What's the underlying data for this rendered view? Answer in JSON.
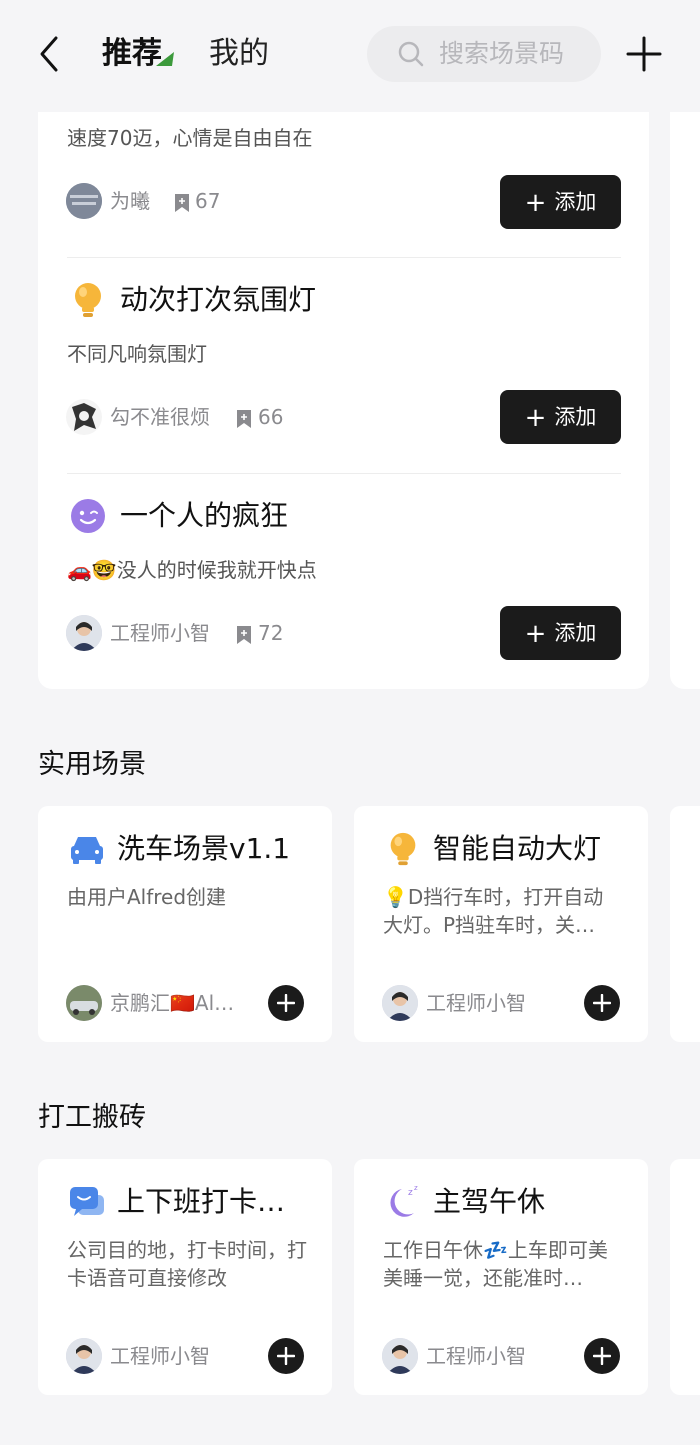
{
  "header": {
    "tab_recommend": "推荐",
    "tab_mine": "我的",
    "search_placeholder": "搜索场景码"
  },
  "feed": [
    {
      "title": "",
      "desc": "速度70迈，心情是自由自在",
      "author": "为曦",
      "count": "67",
      "add_label": "添加"
    },
    {
      "title": "动次打次氛围灯",
      "icon": "lightbulb-icon",
      "desc": "不同凡响氛围灯",
      "author": "勾不准很烦",
      "count": "66",
      "add_label": "添加"
    },
    {
      "title": "一个人的疯狂",
      "icon": "wink-face-icon",
      "desc": "🚗🤓没人的时候我就开快点",
      "author": "工程师小智",
      "count": "72",
      "add_label": "添加"
    }
  ],
  "sections": [
    {
      "title": "实用场景",
      "cards": [
        {
          "icon": "car-icon",
          "title": "洗车场景v1.1",
          "desc": "由用户Alfred创建",
          "author": "京鹏汇🇨🇳Al…"
        },
        {
          "icon": "lightbulb-icon",
          "title": "智能自动大灯",
          "desc": "💡D挡行车时，打开自动大灯。P挡驻车时，关…",
          "author": "工程师小智"
        }
      ]
    },
    {
      "title": "打工搬砖",
      "cards": [
        {
          "icon": "chat-bubble-icon",
          "title": "上下班打卡…",
          "desc": "公司目的地，打卡时间，打卡语音可直接修改",
          "author": "工程师小智"
        },
        {
          "icon": "moon-sleep-icon",
          "title": "主驾午休",
          "desc": "工作日午休💤上车即可美美睡一觉，还能准时…",
          "author": "工程师小智"
        }
      ]
    }
  ],
  "colors": {
    "background": "#f5f5f7",
    "card": "#ffffff",
    "button_dark": "#1b1b1b",
    "accent_green": "#3c9a3c",
    "bulb_yellow": "#f6b63a",
    "purple": "#9b7be6",
    "blue": "#4a86e8"
  }
}
